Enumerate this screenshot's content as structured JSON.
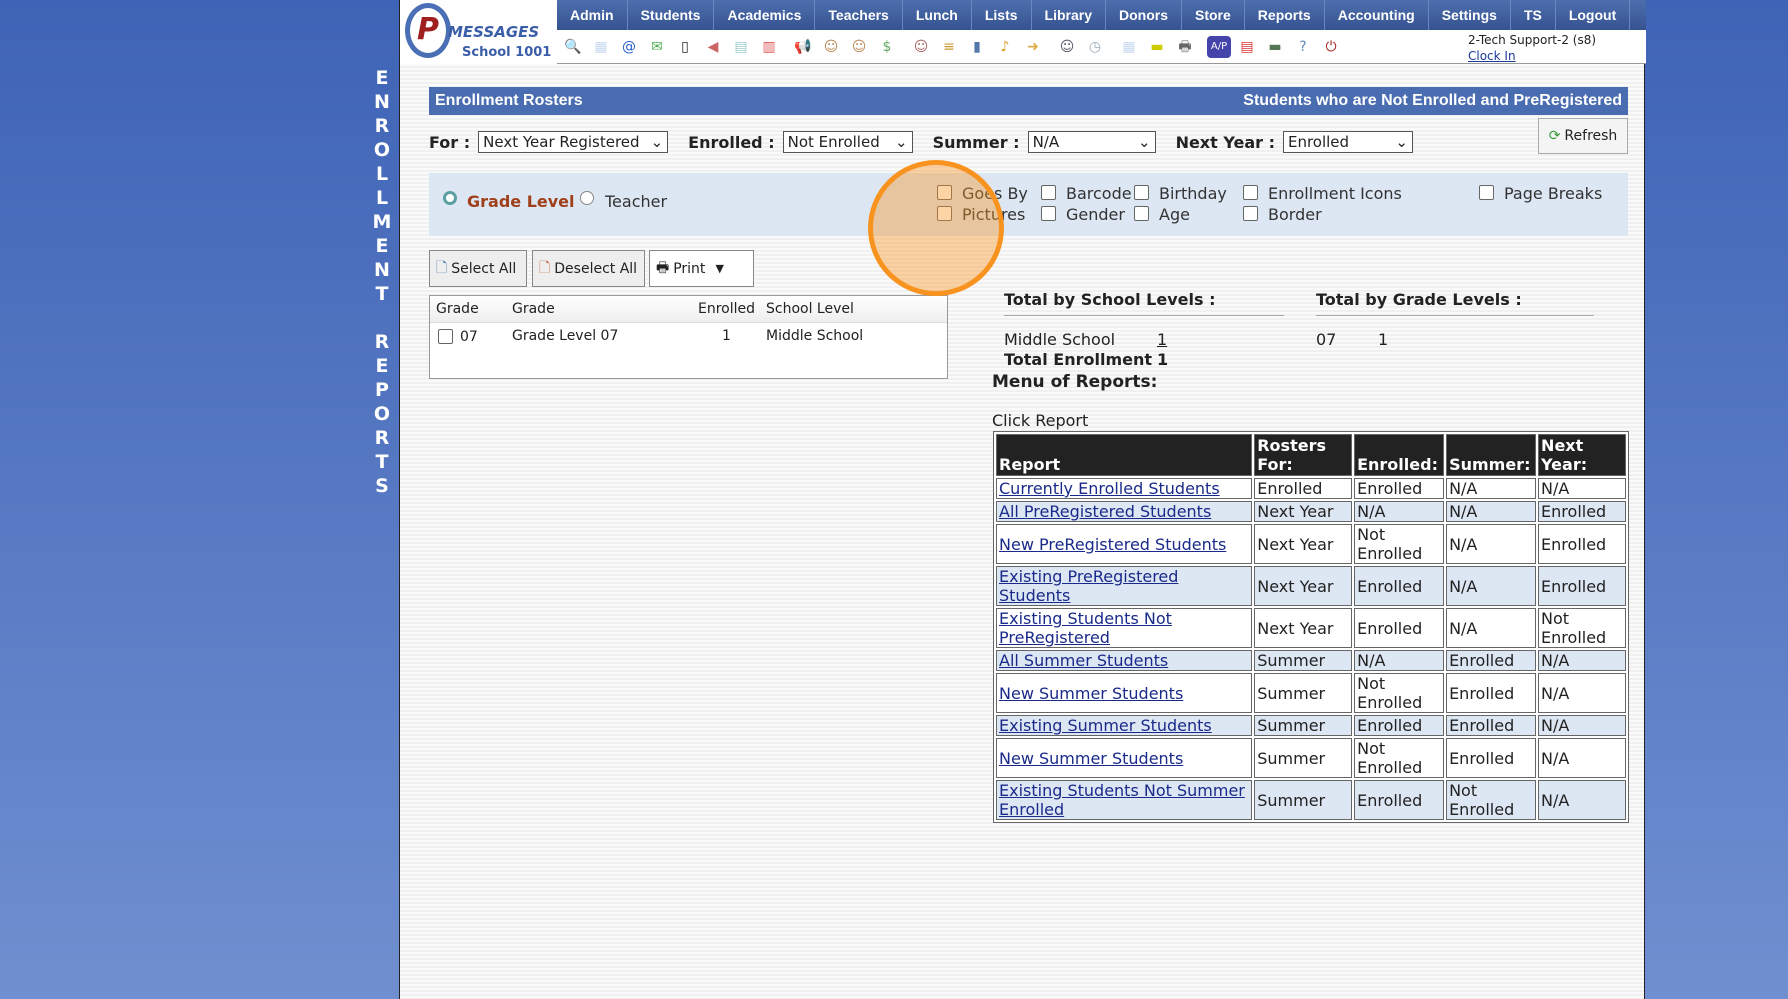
{
  "side_title": [
    "E",
    "N",
    "R",
    "O",
    "L",
    "L",
    "M",
    "E",
    "N",
    "T",
    "",
    "R",
    "E",
    "P",
    "O",
    "R",
    "T",
    "S"
  ],
  "logo": {
    "mark": "P",
    "text": "MESSAGES",
    "school": "School 1001"
  },
  "nav": [
    "Admin",
    "Students",
    "Academics",
    "Teachers",
    "Lunch",
    "Lists",
    "Library",
    "Donors",
    "Store",
    "Reports",
    "Accounting",
    "Settings",
    "TS",
    "Logout"
  ],
  "icons": [
    "search-icon",
    "calendar-grid-icon",
    "email-icon",
    "chat-icon",
    "phone-icon",
    "speaker-icon",
    "report-icon",
    "date-icon",
    "megaphone-icon",
    "add-user-icon",
    "user-icon",
    "money-icon",
    "family-icon",
    "lunch-icon",
    "book-icon",
    "bell-icon",
    "export-icon",
    "staff-icon",
    "clock-icon",
    "spreadsheet-icon",
    "card-icon",
    "printer-icon",
    "ap-icon",
    "pdf-icon",
    "cash-register-icon",
    "help-icon",
    "power-icon"
  ],
  "user": {
    "name": "2-Tech Support-2 (s8)",
    "clock": "Clock In"
  },
  "title": {
    "left": "Enrollment Rosters",
    "right": "Students who are Not Enrolled and PreRegistered"
  },
  "filters": {
    "for_label": "For :",
    "for_value": "Next Year Registered",
    "enrolled_label": "Enrolled :",
    "enrolled_value": "Not Enrolled",
    "summer_label": "Summer :",
    "summer_value": "N/A",
    "next_label": "Next Year :",
    "next_value": "Enrolled",
    "refresh": "Refresh"
  },
  "options": {
    "grade_level": "Grade Level",
    "teacher": "Teacher",
    "checks": [
      "Goes By",
      "Pictures",
      "Barcode",
      "Gender",
      "Birthday",
      "Age",
      "Enrollment Icons",
      "Border",
      "Page Breaks"
    ]
  },
  "buttons": {
    "select_all": "Select All",
    "deselect_all": "Deselect All",
    "print": "Print"
  },
  "grade_table": {
    "headers": [
      "Grade",
      "Grade",
      "Enrolled",
      "School Level"
    ],
    "rows": [
      {
        "grade": "07",
        "name": "Grade Level 07",
        "enrolled": "1",
        "level": "Middle School"
      }
    ]
  },
  "totals": {
    "school_title": "Total by School Levels :",
    "grade_title": "Total by Grade Levels :",
    "school_name": "Middle School",
    "school_count": "1",
    "total_label": "Total Enrollment",
    "total_count": "1",
    "grade": "07",
    "grade_count": "1",
    "menu": "Menu of Reports:",
    "click": "Click Report"
  },
  "reports": {
    "headers": [
      "Report",
      "Rosters For:",
      "Enrolled:",
      "Summer:",
      "Next Year:"
    ],
    "rows": [
      [
        "Currently Enrolled Students",
        "Enrolled",
        "Enrolled",
        "N/A",
        "N/A"
      ],
      [
        "All PreRegistered Students",
        "Next Year",
        "N/A",
        "N/A",
        "Enrolled"
      ],
      [
        "New PreRegistered Students",
        "Next Year",
        "Not Enrolled",
        "N/A",
        "Enrolled"
      ],
      [
        "Existing PreRegistered Students",
        "Next Year",
        "Enrolled",
        "N/A",
        "Enrolled"
      ],
      [
        "Existing Students Not PreRegistered",
        "Next Year",
        "Enrolled",
        "N/A",
        "Not Enrolled"
      ],
      [
        "All Summer Students",
        "Summer",
        "N/A",
        "Enrolled",
        "N/A"
      ],
      [
        "New Summer Students",
        "Summer",
        "Not Enrolled",
        "Enrolled",
        "N/A"
      ],
      [
        "Existing Summer Students",
        "Summer",
        "Enrolled",
        "Enrolled",
        "N/A"
      ],
      [
        "New Summer Students",
        "Summer",
        "Not Enrolled",
        "Enrolled",
        "N/A"
      ],
      [
        "Existing Students Not Summer Enrolled",
        "Summer",
        "Enrolled",
        "Not Enrolled",
        "N/A"
      ]
    ]
  }
}
